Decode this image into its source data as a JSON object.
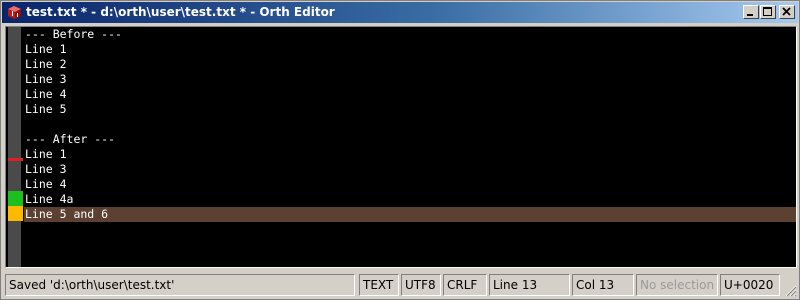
{
  "window": {
    "title": "test.txt * - d:\\orth\\user\\test.txt * - Orth Editor"
  },
  "editor": {
    "lines": [
      "--- Before ---",
      "Line 1",
      "Line 2",
      "Line 3",
      "Line 4",
      "Line 5",
      "",
      "--- After ---",
      "Line 1",
      "Line 3",
      "Line 4",
      "Line 4a",
      "Line 5 and 6"
    ],
    "current_line": 13,
    "colors": {
      "background": "#000000",
      "text": "#ffffff",
      "current_line_bg": "#5c4032",
      "gutter": "#4a4a4a",
      "deleted_marker": "#e02020",
      "added_marker": "#1cc01c",
      "modified_marker": "#ffb800"
    }
  },
  "statusbar": {
    "message": "Saved 'd:\\orth\\user\\test.txt'",
    "mode": "TEXT",
    "encoding": "UTF8",
    "line_ending": "CRLF",
    "line": "Line 13",
    "column": "Col 13",
    "selection": "No selection",
    "char_code": "U+0020"
  }
}
